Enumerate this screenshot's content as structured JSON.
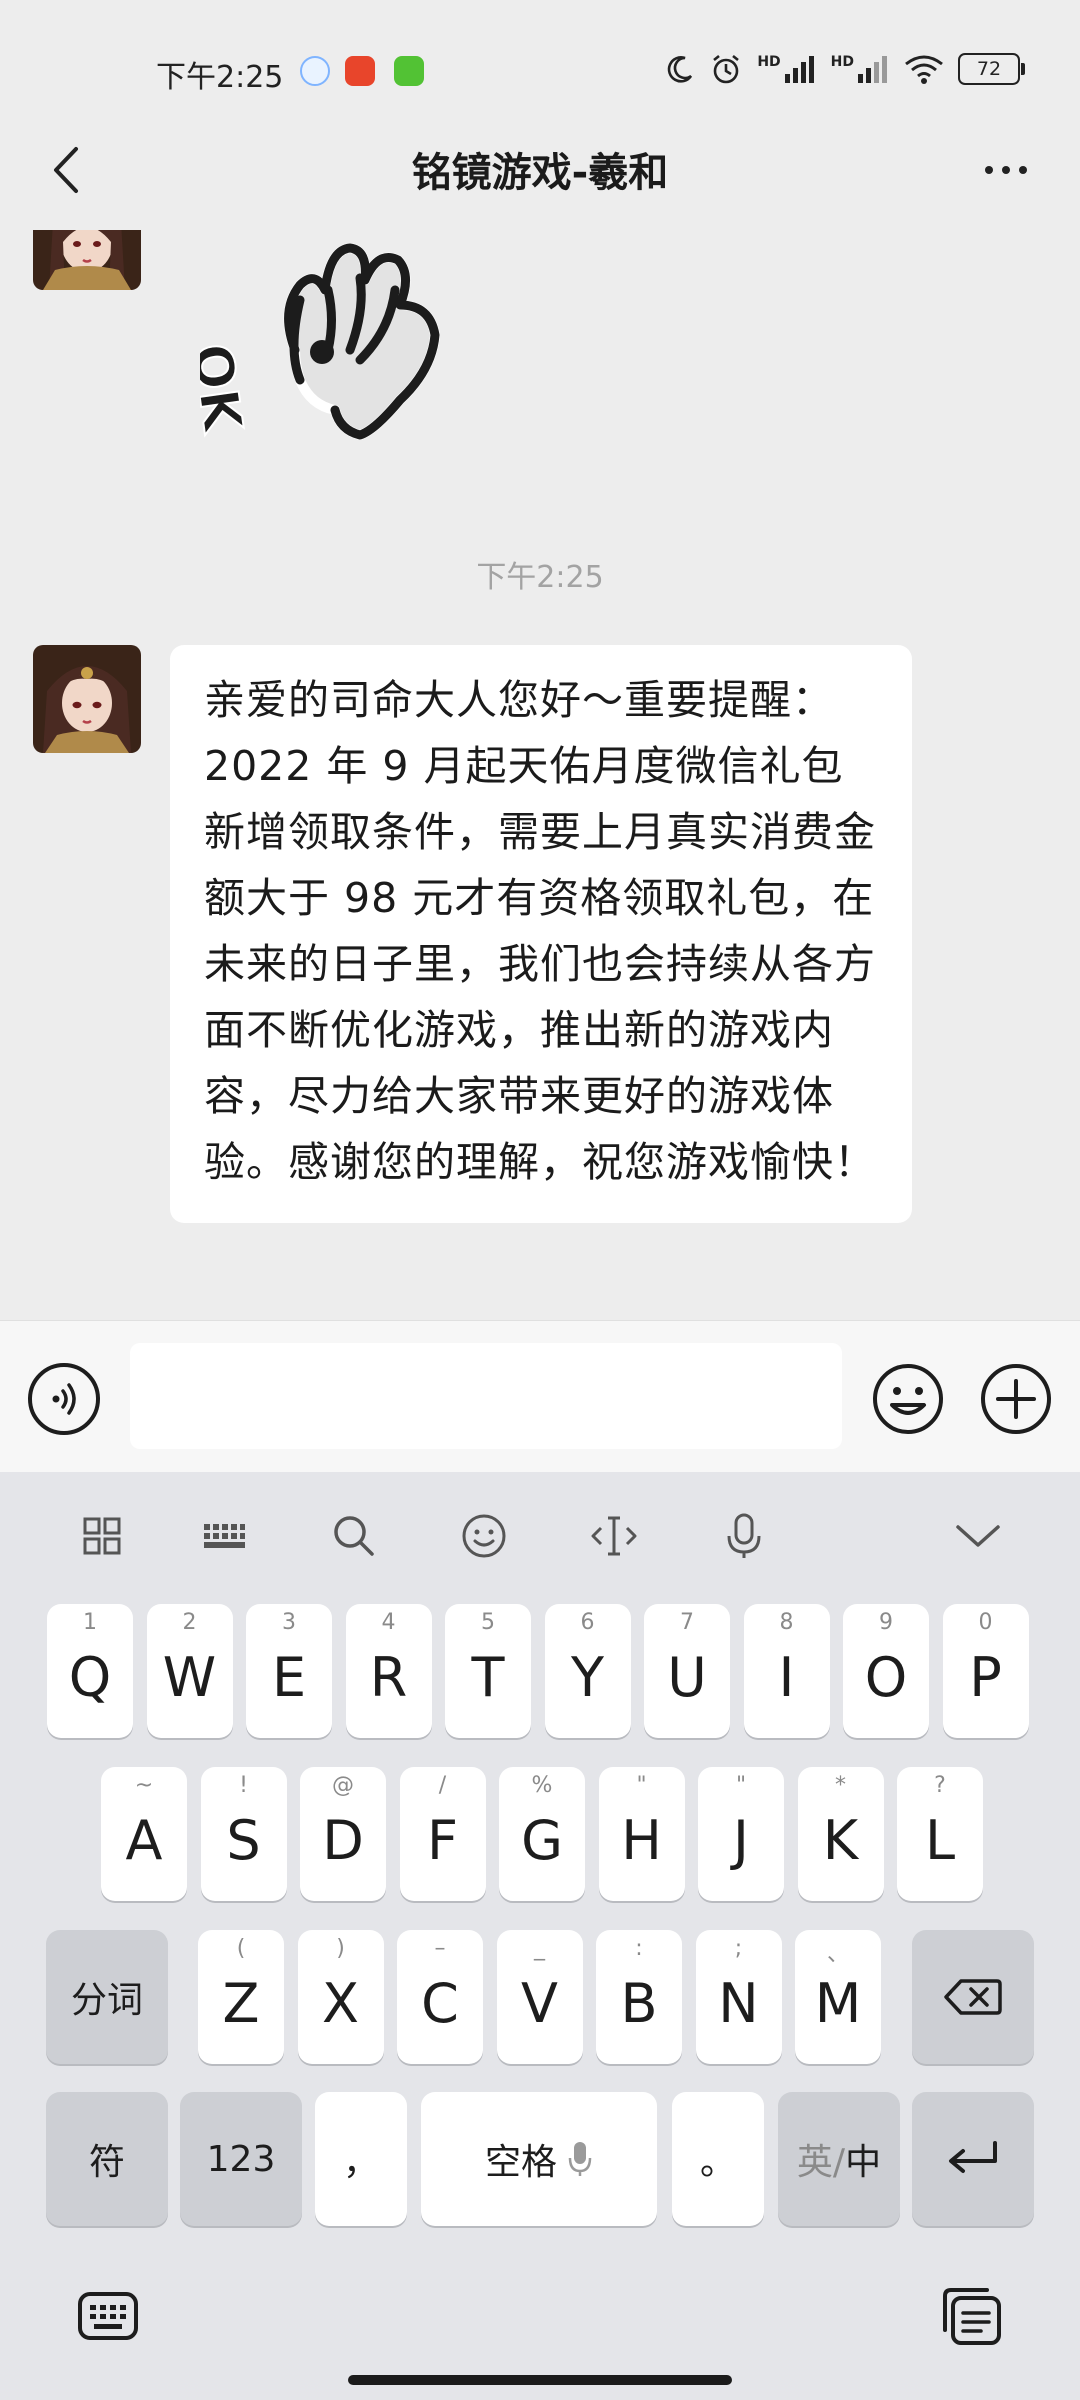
{
  "status_bar": {
    "time": "下午2:25",
    "battery": "72",
    "network_hd_1": "HD",
    "network_hd_2": "HD"
  },
  "nav": {
    "title": "铭镜游戏-羲和"
  },
  "chat": {
    "time_divider": "下午2:25",
    "sticker_text": "OK",
    "message": "亲爱的司命大人您好～重要提醒：2022 年 9 月起天佑月度微信礼包新增领取条件，需要上月真实消费金额大于 98 元才有资格领取礼包，在未来的日子里，我们也会持续从各方面不断优化游戏，推出新的游戏内容，尽力给大家带来更好的游戏体验。感谢您的理解，祝您游戏愉快！"
  },
  "input": {
    "value": "",
    "placeholder": ""
  },
  "keyboard": {
    "row1": [
      {
        "letter": "Q",
        "hint": "1"
      },
      {
        "letter": "W",
        "hint": "2"
      },
      {
        "letter": "E",
        "hint": "3"
      },
      {
        "letter": "R",
        "hint": "4"
      },
      {
        "letter": "T",
        "hint": "5"
      },
      {
        "letter": "Y",
        "hint": "6"
      },
      {
        "letter": "U",
        "hint": "7"
      },
      {
        "letter": "I",
        "hint": "8"
      },
      {
        "letter": "O",
        "hint": "9"
      },
      {
        "letter": "P",
        "hint": "0"
      }
    ],
    "row2": [
      {
        "letter": "A",
        "hint": "~"
      },
      {
        "letter": "S",
        "hint": "!"
      },
      {
        "letter": "D",
        "hint": "@"
      },
      {
        "letter": "F",
        "hint": "/"
      },
      {
        "letter": "G",
        "hint": "%"
      },
      {
        "letter": "H",
        "hint": "\""
      },
      {
        "letter": "J",
        "hint": "\""
      },
      {
        "letter": "K",
        "hint": "*"
      },
      {
        "letter": "L",
        "hint": "?"
      }
    ],
    "row3": [
      {
        "letter": "Z",
        "hint": "("
      },
      {
        "letter": "X",
        "hint": ")"
      },
      {
        "letter": "C",
        "hint": "–"
      },
      {
        "letter": "V",
        "hint": "_"
      },
      {
        "letter": "B",
        "hint": ":"
      },
      {
        "letter": "N",
        "hint": ";"
      },
      {
        "letter": "M",
        "hint": "、"
      }
    ],
    "segment_label": "分词",
    "symbol_label": "符",
    "numeric_label": "123",
    "comma_label": "，",
    "space_label": "空格",
    "period_label": "。",
    "lang_en": "英/",
    "lang_zh": "中"
  },
  "colors": {
    "background": "#ededed",
    "bubble": "#ffffff",
    "keyboard_bg": "#e4e5e9",
    "key_gray": "#cdcfd4"
  }
}
